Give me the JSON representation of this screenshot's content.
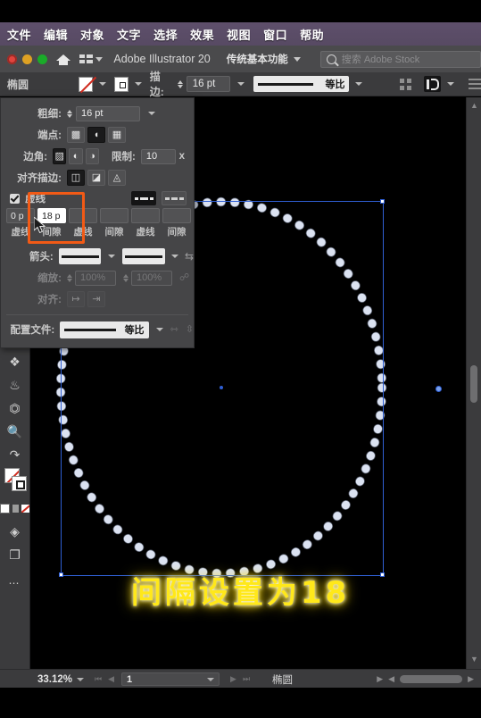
{
  "menu": {
    "items": [
      "文件",
      "编辑",
      "对象",
      "文字",
      "选择",
      "效果",
      "视图",
      "窗口",
      "帮助"
    ]
  },
  "titlebar": {
    "app_name": "Adobe Illustrator 20",
    "workspace": "传统基本功能",
    "search_placeholder": "搜索 Adobe Stock"
  },
  "control_bar": {
    "object_label": "椭圆",
    "stroke_label": "描边:",
    "stroke_weight": "16 pt",
    "profile_text": "等比"
  },
  "stroke_panel": {
    "weight_label": "粗细:",
    "weight_value": "16 pt",
    "cap_label": "端点:",
    "corner_label": "边角:",
    "limit_label": "限制:",
    "limit_value": "10",
    "limit_unit": "x",
    "align_label": "对齐描边:",
    "dashed_label": "虚线",
    "dash_fields": [
      {
        "value": "0 p",
        "label": "虚线",
        "active": false
      },
      {
        "value": "18 p",
        "label": "间隙",
        "active": true
      },
      {
        "value": "",
        "label": "虚线",
        "active": false
      },
      {
        "value": "",
        "label": "间隙",
        "active": false
      },
      {
        "value": "",
        "label": "虚线",
        "active": false
      },
      {
        "value": "",
        "label": "间隙",
        "active": false
      }
    ],
    "arrow_label": "箭头:",
    "scale_label": "缩放:",
    "scale_value_1": "100%",
    "scale_value_2": "100%",
    "align_arrow_label": "对齐:",
    "profile_label": "配置文件:",
    "profile_value": "等比"
  },
  "canvas": {
    "caption": "间隔设置为18"
  },
  "status_bar": {
    "zoom": "33.12%",
    "page": "1",
    "tool": "椭圆"
  },
  "colors": {
    "accent_highlight": "#f25a16",
    "caption_yellow": "#ffe81a",
    "selection_blue": "#2f5fd4",
    "menu_purple": "#5e4f6b"
  }
}
